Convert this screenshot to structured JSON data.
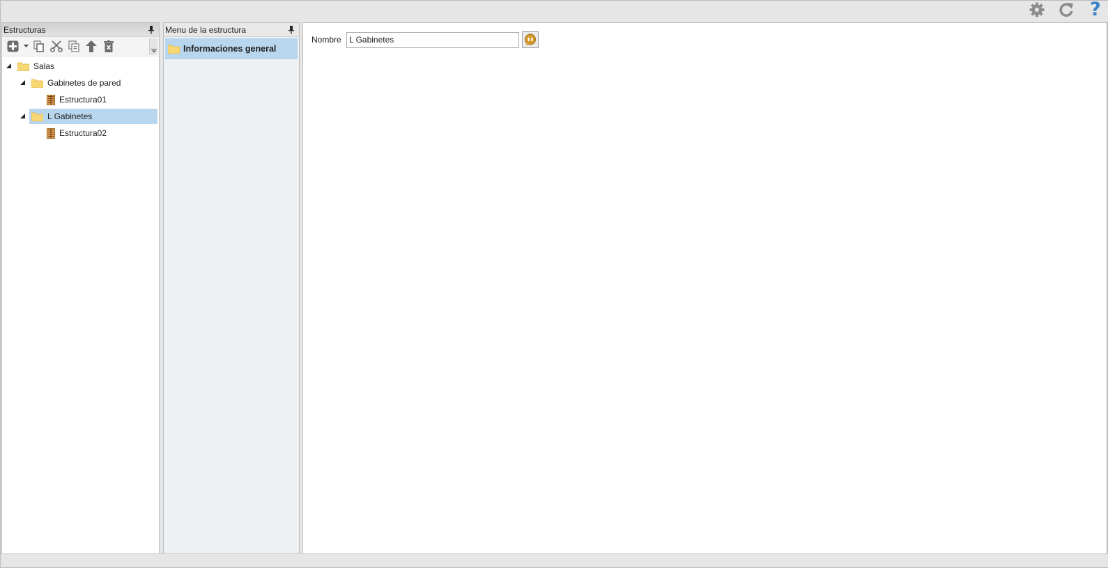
{
  "topbar": {
    "icons": [
      "gear-icon",
      "refresh-icon",
      "help-icon"
    ],
    "help_glyph": "?"
  },
  "left_panel": {
    "title": "Estructuras",
    "toolbar": [
      "add-icon",
      "dropdown-arrow-icon",
      "copy-icon",
      "cut-icon",
      "duplicate-icon",
      "move-up-icon",
      "delete-icon"
    ],
    "tree": [
      {
        "label": "Salas",
        "type": "folder",
        "level": 0,
        "expanded": true,
        "selected": false
      },
      {
        "label": "Gabinetes de pared",
        "type": "folder",
        "level": 1,
        "expanded": true,
        "selected": false
      },
      {
        "label": "Estructura01",
        "type": "structure",
        "level": 2,
        "selected": false
      },
      {
        "label": "L Gabinetes",
        "type": "folder",
        "level": 1,
        "expanded": true,
        "selected": true
      },
      {
        "label": "Estructura02",
        "type": "structure",
        "level": 2,
        "selected": false
      }
    ]
  },
  "mid_panel": {
    "title": "Menu de la estructura",
    "items": [
      {
        "label": "Informaciones general",
        "selected": true
      }
    ]
  },
  "form": {
    "nombre_label": "Nombre",
    "nombre_value": "L Gabinetes"
  },
  "colors": {
    "selection": "#b8d6ee",
    "folder": "#f7d774",
    "help_accent": "#3c83c9",
    "translate_badge": "#d69a2d"
  }
}
